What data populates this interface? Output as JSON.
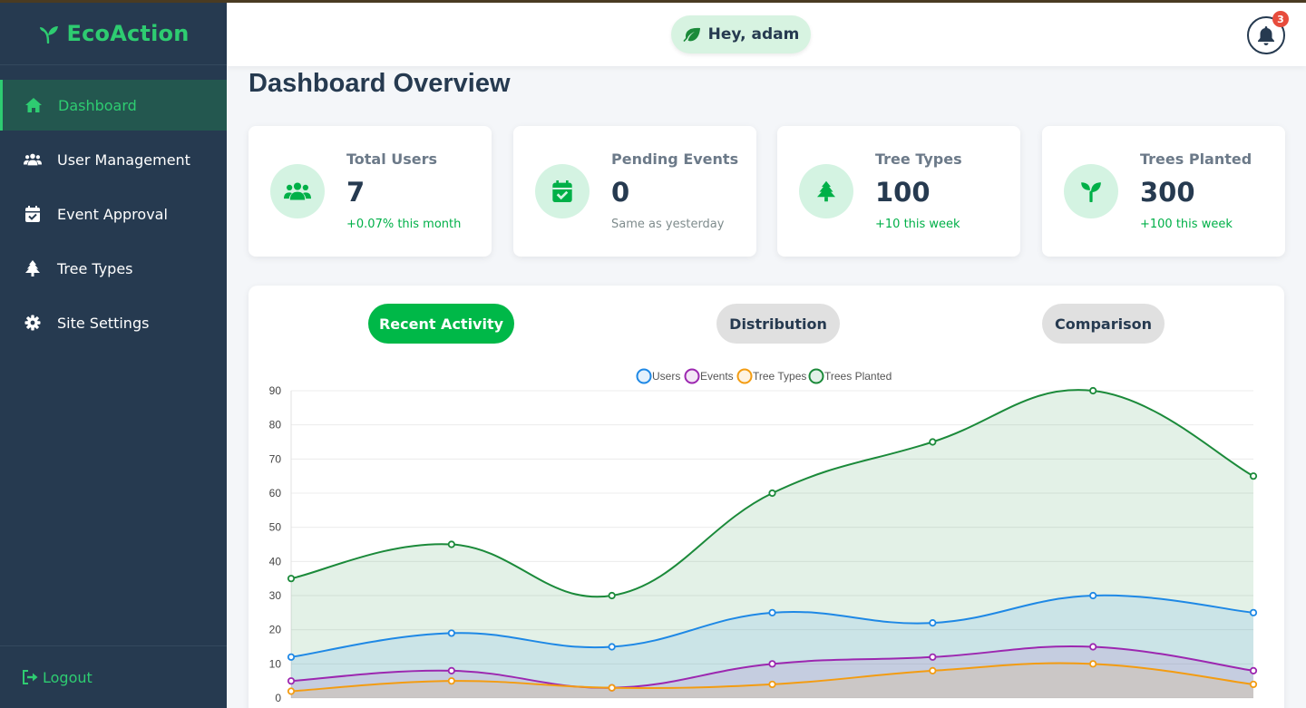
{
  "brand": {
    "name": "EcoAction"
  },
  "sidebar": {
    "items": [
      {
        "label": "Dashboard",
        "icon": "home-icon",
        "active": true
      },
      {
        "label": "User Management",
        "icon": "users-icon",
        "active": false
      },
      {
        "label": "Event Approval",
        "icon": "calendar-check-icon",
        "active": false
      },
      {
        "label": "Tree Types",
        "icon": "tree-icon",
        "active": false
      },
      {
        "label": "Site Settings",
        "icon": "gear-icon",
        "active": false
      }
    ],
    "logout_label": "Logout"
  },
  "header": {
    "greeting": "Hey, adam",
    "notification_count": "3"
  },
  "main": {
    "title": "Dashboard Overview",
    "stats": [
      {
        "label": "Total Users",
        "value": "7",
        "change": "+0.07% this month",
        "icon": "users-icon"
      },
      {
        "label": "Pending Events",
        "value": "0",
        "change": "Same as yesterday",
        "icon": "calendar-check-icon"
      },
      {
        "label": "Tree Types",
        "value": "100",
        "change": "+10 this week",
        "icon": "tree-icon"
      },
      {
        "label": "Trees Planted",
        "value": "300",
        "change": "+100 this week",
        "icon": "seedling-icon"
      }
    ],
    "tabs": [
      {
        "label": "Recent Activity",
        "active": true
      },
      {
        "label": "Distribution",
        "active": false
      },
      {
        "label": "Comparison",
        "active": false
      }
    ]
  },
  "colors": {
    "accent": "#2ecc71",
    "sidebar_bg": "#263a50",
    "users": "#1e88e5",
    "events": "#9c27b0",
    "tree_types": "#f39c12",
    "trees_planted": "#1b8a3a"
  },
  "chart_data": {
    "type": "area",
    "title": "",
    "xlabel": "",
    "ylabel": "",
    "ylim": [
      0,
      90
    ],
    "yticks": [
      0,
      10,
      20,
      30,
      40,
      50,
      60,
      70,
      80,
      90
    ],
    "grid": true,
    "legend_position": "top",
    "points_per_series": 7,
    "series": [
      {
        "name": "Users",
        "color": "#1e88e5",
        "values": [
          12,
          19,
          15,
          25,
          22,
          30,
          25
        ]
      },
      {
        "name": "Events",
        "color": "#9c27b0",
        "values": [
          5,
          8,
          3,
          10,
          12,
          15,
          8
        ]
      },
      {
        "name": "Tree Types",
        "color": "#f39c12",
        "values": [
          2,
          5,
          3,
          4,
          8,
          10,
          4
        ]
      },
      {
        "name": "Trees Planted",
        "color": "#1b8a3a",
        "values": [
          35,
          45,
          30,
          60,
          75,
          90,
          65
        ]
      }
    ]
  }
}
